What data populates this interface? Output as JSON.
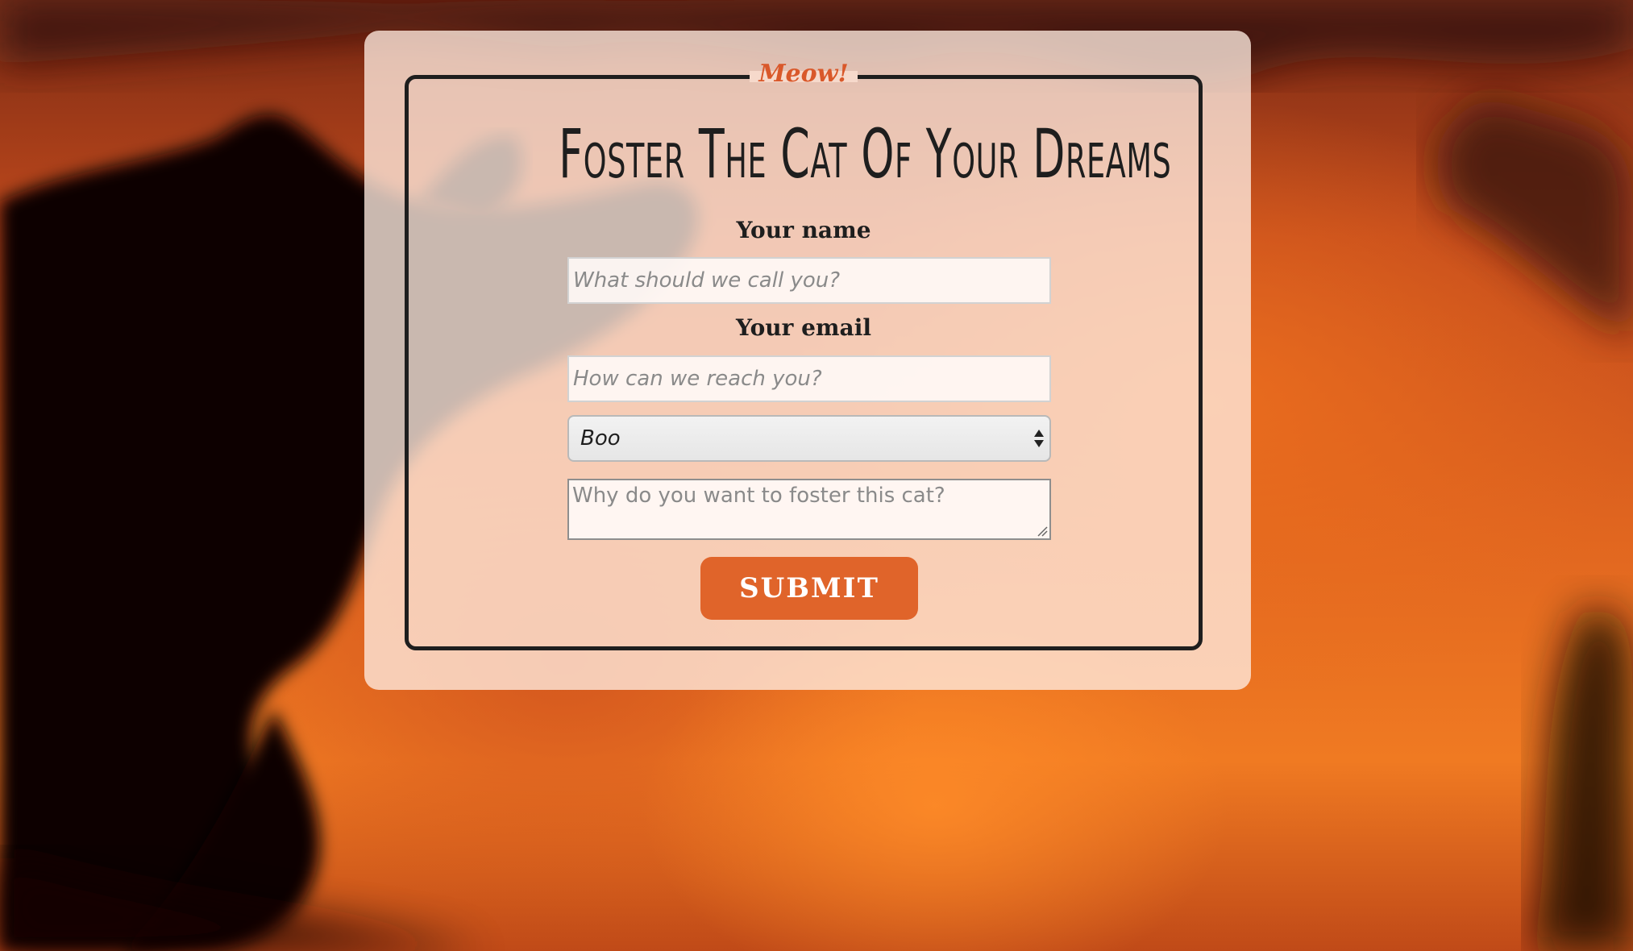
{
  "form": {
    "legend": "Meow!",
    "title": "Foster The Cat Of Your Dreams",
    "name_label": "Your name",
    "name_placeholder": "What should we call you?",
    "email_label": "Your email",
    "email_placeholder": "How can we reach you?",
    "cat_select_value": "Boo",
    "reason_placeholder": "Why do you want to foster this cat?",
    "submit_label": "SUBMIT"
  },
  "colors": {
    "accent": "#e0642a",
    "legend": "#d9582a",
    "text": "#1e1e1e"
  },
  "icons": {
    "select_arrows": "select-arrows-icon",
    "resize_grip": "resize-grip-icon"
  }
}
